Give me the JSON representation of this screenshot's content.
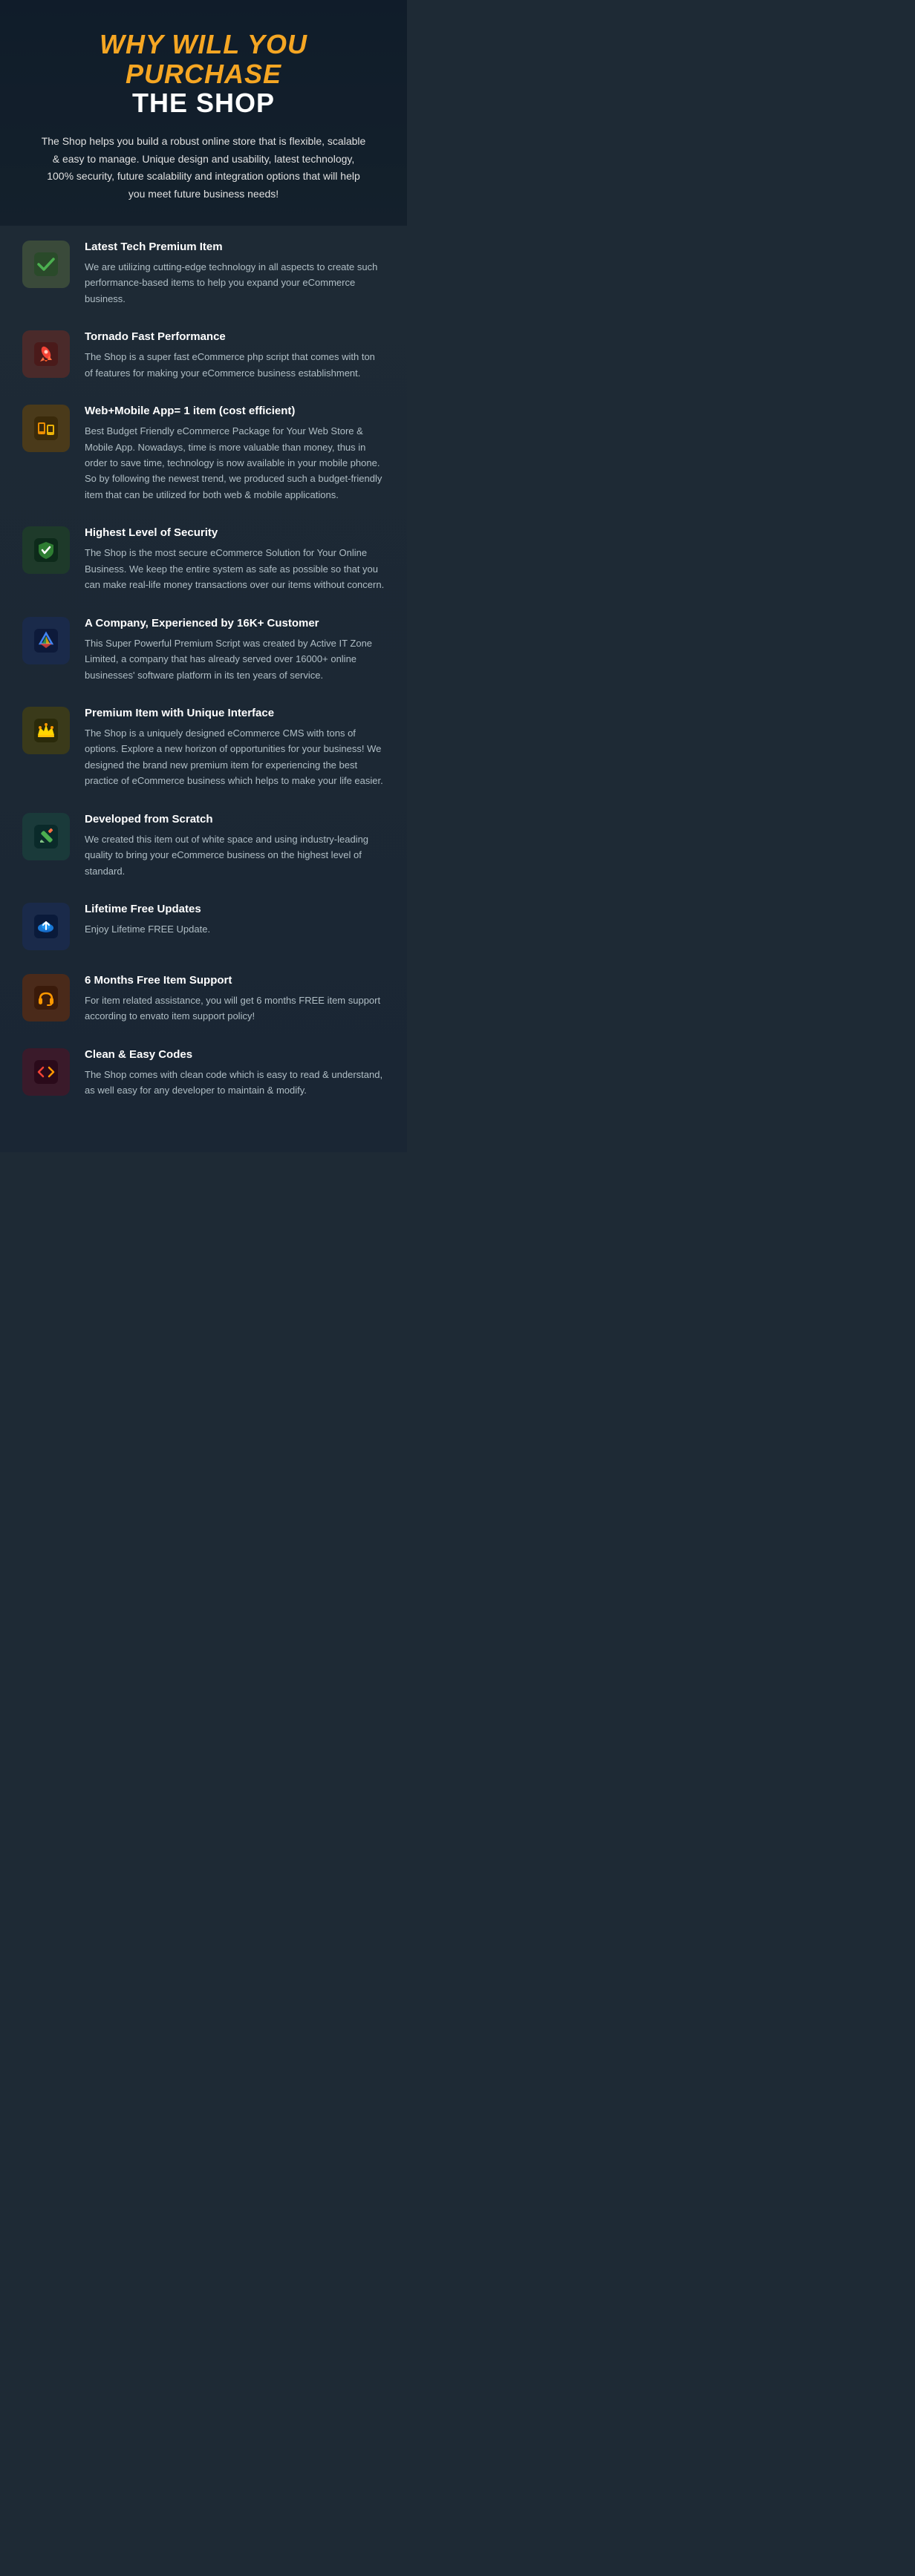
{
  "header": {
    "title_line1": "WHY WILL YOU PURCHASE",
    "title_line2": "THE SHOP",
    "subtitle": "The Shop helps you build a robust online store that is flexible, scalable & easy to manage. Unique design and usability, latest technology, 100% security, future scalability and integration options that will help you meet future business needs!"
  },
  "features": [
    {
      "id": "latest-tech",
      "icon_color": "icon-green",
      "icon_type": "checkmark",
      "title": "Latest Tech Premium Item",
      "description": "We are utilizing cutting-edge technology in all aspects to create such performance-based items to help you expand your eCommerce business."
    },
    {
      "id": "fast-performance",
      "icon_color": "icon-red",
      "icon_type": "rocket",
      "title": "Tornado Fast Performance",
      "description": "The Shop is a super fast eCommerce php script that comes with ton of features for making your eCommerce business establishment."
    },
    {
      "id": "web-mobile",
      "icon_color": "icon-orange",
      "icon_type": "mobile",
      "title": "Web+Mobile App= 1 item (cost efficient)",
      "description": "Best Budget Friendly eCommerce Package for Your Web Store & Mobile App. Nowadays, time is more valuable than money, thus in order to save time, technology is now available in your mobile phone. So by following the newest trend, we produced such a budget-friendly item that can be utilized for both web & mobile applications."
    },
    {
      "id": "security",
      "icon_color": "icon-darkgreen",
      "icon_type": "shield",
      "title": "Highest Level of Security",
      "description": "The Shop is the most secure eCommerce Solution for Your Online Business. We keep the entire system as safe as possible so that you can make real-life money transactions over our items without concern."
    },
    {
      "id": "company",
      "icon_color": "icon-blue",
      "icon_type": "triangle",
      "title": "A Company, Experienced by 16K+ Customer",
      "description": "This Super Powerful Premium Script was created by Active IT Zone Limited, a company that has already served over 16000+ online businesses' software platform in its ten years of service."
    },
    {
      "id": "premium-item",
      "icon_color": "icon-yellow",
      "icon_type": "crown",
      "title": "Premium Item with Unique Interface",
      "description": "The Shop is a uniquely designed eCommerce CMS with tons of options. Explore a new horizon of opportunities for your business!  We designed the brand new premium item for experiencing the best practice of eCommerce business which helps to make your life easier."
    },
    {
      "id": "scratch",
      "icon_color": "icon-teal",
      "icon_type": "pencil",
      "title": "Developed from Scratch",
      "description": "We created this item out of white space and using industry-leading quality to bring your eCommerce business on the highest level of standard."
    },
    {
      "id": "updates",
      "icon_color": "icon-cloud",
      "icon_type": "cloud",
      "title": "Lifetime Free Updates",
      "description": "Enjoy Lifetime FREE Update."
    },
    {
      "id": "support",
      "icon_color": "icon-orange2",
      "icon_type": "headphone",
      "title": "6 Months Free Item Support",
      "description": "For item related assistance, you will get 6 months FREE item support according to envato item support policy!"
    },
    {
      "id": "clean-code",
      "icon_color": "icon-red2",
      "icon_type": "code",
      "title": "Clean & Easy Codes",
      "description": "The Shop comes with clean code which is easy to read & understand, as well easy for any developer to maintain & modify."
    }
  ]
}
